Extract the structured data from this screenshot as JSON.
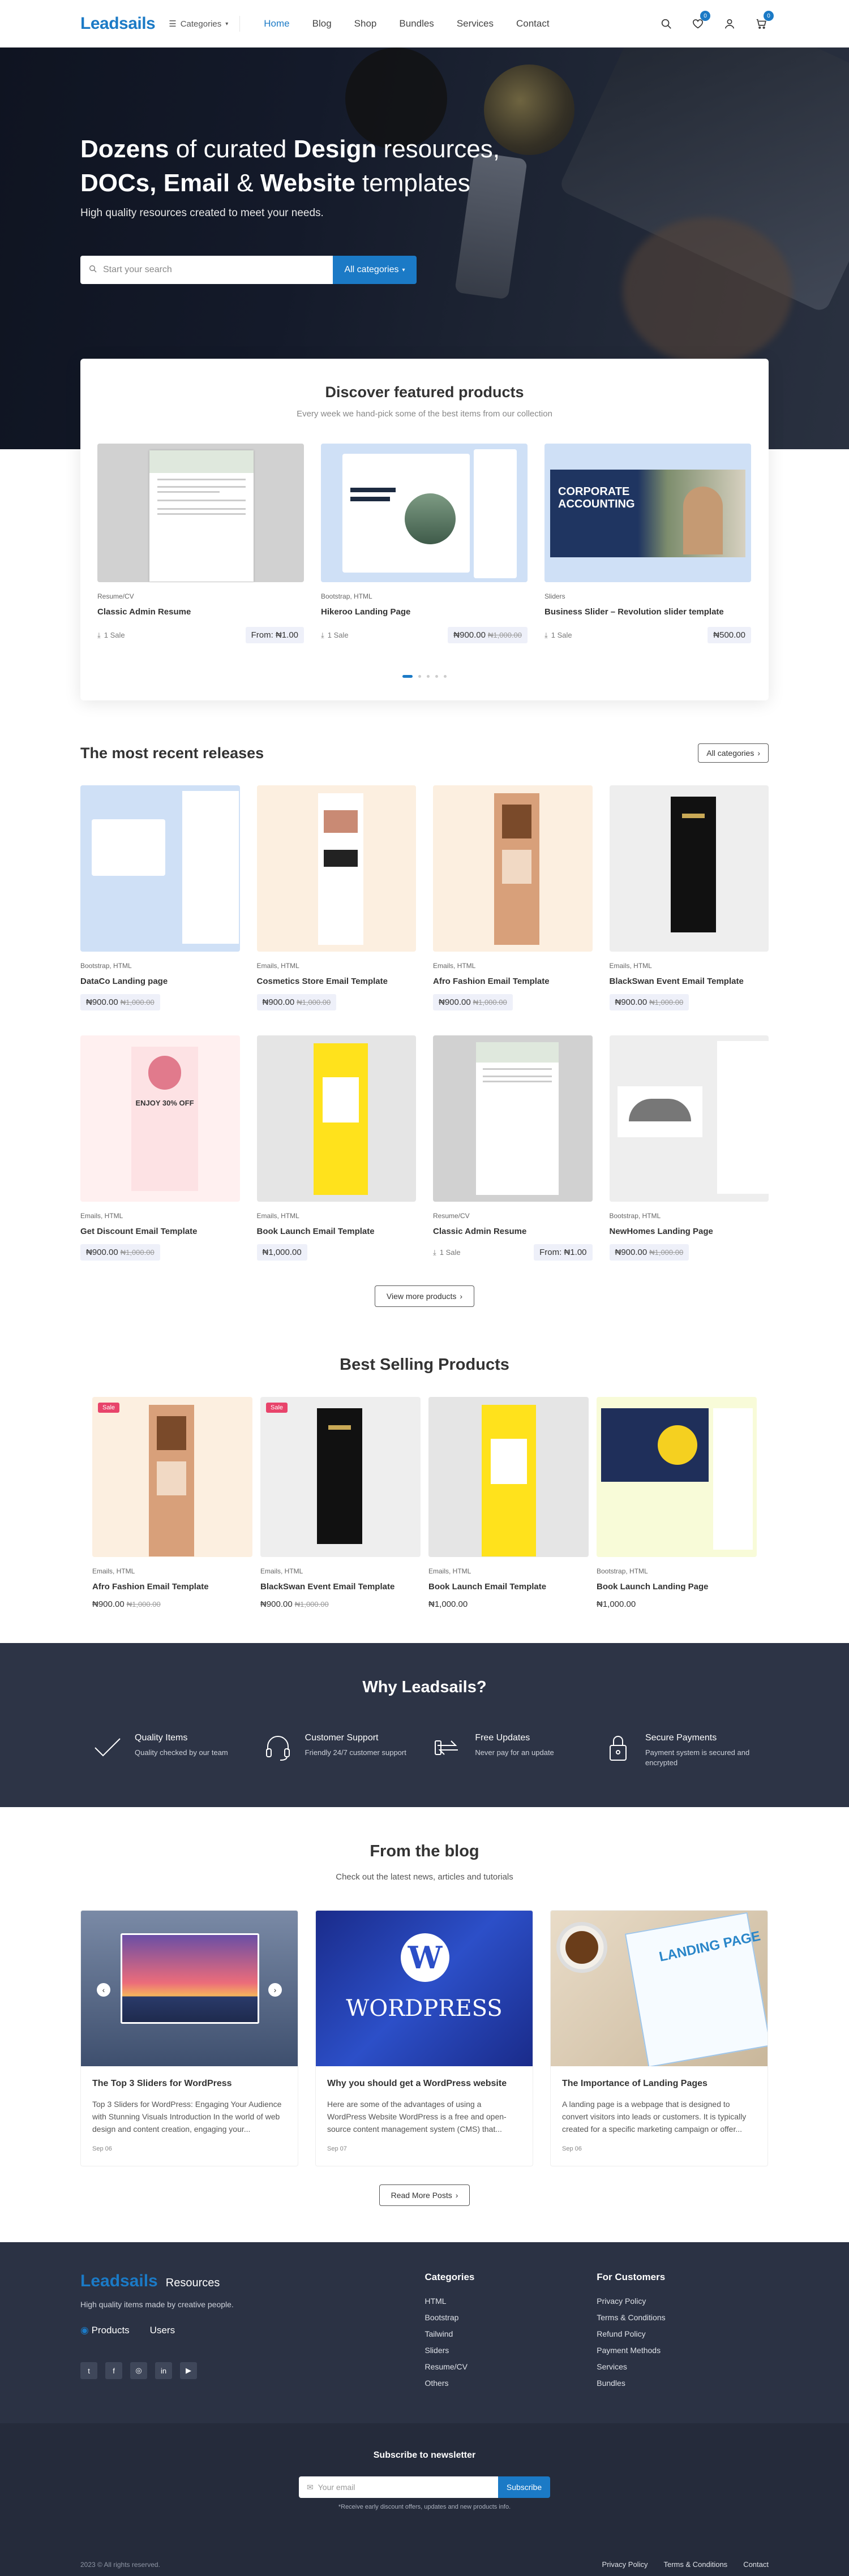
{
  "header": {
    "logo": "Leadsails",
    "categories_label": "Categories",
    "nav": [
      "Home",
      "Blog",
      "Shop",
      "Bundles",
      "Services",
      "Contact"
    ],
    "wishlist_count": "0",
    "cart_count": "0"
  },
  "hero": {
    "line1_a": "Dozens",
    "line1_b": " of curated ",
    "line1_c": "Design",
    "line1_d": " resources,",
    "line2_a": "DOCs, Email",
    "line2_b": " & ",
    "line2_c": "Website",
    "line2_d": " templates",
    "subtitle": "High quality resources created to meet your needs.",
    "search_placeholder": "Start your search",
    "search_button": "All categories"
  },
  "featured": {
    "title": "Discover featured products",
    "subtitle": "Every week we hand-pick some of the best items from our collection",
    "items": [
      {
        "meta": "Resume/CV",
        "name": "Classic Admin Resume",
        "sales": "1 Sale",
        "price": "From: ₦1.00",
        "old": ""
      },
      {
        "meta": "Bootstrap, HTML",
        "name": "Hikeroo Landing Page",
        "sales": "1 Sale",
        "price": "₦900.00",
        "old": "₦1,000.00"
      },
      {
        "meta": "Sliders",
        "name": "Business Slider – Revolution slider template",
        "sales": "1 Sale",
        "price": "₦500.00",
        "old": ""
      }
    ]
  },
  "recent": {
    "title": "The most recent releases",
    "all_button": "All categories",
    "more_button": "View more products",
    "items": [
      {
        "meta": "Bootstrap, HTML",
        "name": "DataCo Landing page",
        "sales": "",
        "price": "₦900.00",
        "old": "₦1,000.00"
      },
      {
        "meta": "Emails, HTML",
        "name": "Cosmetics Store Email Template",
        "sales": "",
        "price": "₦900.00",
        "old": "₦1,000.00"
      },
      {
        "meta": "Emails, HTML",
        "name": "Afro Fashion Email Template",
        "sales": "",
        "price": "₦900.00",
        "old": "₦1,000.00"
      },
      {
        "meta": "Emails, HTML",
        "name": "BlackSwan Event Email Template",
        "sales": "",
        "price": "₦900.00",
        "old": "₦1,000.00"
      },
      {
        "meta": "Emails, HTML",
        "name": "Get Discount Email Template",
        "sales": "",
        "price": "₦900.00",
        "old": "₦1,000.00"
      },
      {
        "meta": "Emails, HTML",
        "name": "Book Launch Email Template",
        "sales": "",
        "price": "₦1,000.00",
        "old": ""
      },
      {
        "meta": "Resume/CV",
        "name": "Classic Admin Resume",
        "sales": "1 Sale",
        "price": "From: ₦1.00",
        "old": ""
      },
      {
        "meta": "Bootstrap, HTML",
        "name": "NewHomes Landing Page",
        "sales": "",
        "price": "₦900.00",
        "old": "₦1,000.00"
      }
    ]
  },
  "best": {
    "title": "Best Selling Products",
    "items": [
      {
        "badge": "Sale",
        "meta": "Emails, HTML",
        "name": "Afro Fashion Email Template",
        "price": "₦900.00",
        "old": "₦1,000.00"
      },
      {
        "badge": "Sale",
        "meta": "Emails, HTML",
        "name": "BlackSwan Event Email Template",
        "price": "₦900.00",
        "old": "₦1,000.00"
      },
      {
        "badge": "",
        "meta": "Emails, HTML",
        "name": "Book Launch Email Template",
        "price": "₦1,000.00",
        "old": ""
      },
      {
        "badge": "",
        "meta": "Bootstrap, HTML",
        "name": "Book Launch Landing Page",
        "price": "₦1,000.00",
        "old": ""
      }
    ]
  },
  "why": {
    "title": "Why Leadsails?",
    "items": [
      {
        "title": "Quality Items",
        "desc": "Quality checked by our team",
        "icon": "check-icon"
      },
      {
        "title": "Customer Support",
        "desc": "Friendly 24/7 customer support",
        "icon": "headset-icon"
      },
      {
        "title": "Free Updates",
        "desc": "Never pay for an update",
        "icon": "refresh-icon"
      },
      {
        "title": "Secure Payments",
        "desc": "Payment system is secured and encrypted",
        "icon": "lock-icon"
      }
    ]
  },
  "blog": {
    "title": "From the blog",
    "subtitle": "Check out the latest news, articles and tutorials",
    "more_button": "Read More Posts",
    "posts": [
      {
        "title": "The Top 3 Sliders for WordPress",
        "excerpt": "Top 3 Sliders for WordPress: Engaging Your Audience with Stunning Visuals Introduction In the world of web design and content creation, engaging your...",
        "date": "Sep 06"
      },
      {
        "title": "Why you should get a WordPress website",
        "excerpt": "Here are some of the advantages of using a WordPress Website WordPress is a free and open-source content management system (CMS) that...",
        "date": "Sep 07"
      },
      {
        "title": "The Importance of Landing Pages",
        "excerpt": "A landing page is a webpage that is designed to convert visitors into leads or customers. It is typically created for a specific marketing campaign or offer...",
        "date": "Sep 06"
      }
    ],
    "img2_text": "WordPress",
    "img3_text": "LANDING PAGE"
  },
  "footer": {
    "logo": "Leadsails",
    "logo_suffix": "Resources",
    "tagline": "High quality items made by creative people.",
    "stat1": "Products",
    "stat2": "Users",
    "categories_title": "Categories",
    "categories": [
      "HTML",
      "Bootstrap",
      "Tailwind",
      "Sliders",
      "Resume/CV",
      "Others"
    ],
    "customers_title": "For Customers",
    "customers": [
      "Privacy Policy",
      "Terms & Conditions",
      "Refund Policy",
      "Payment Methods",
      "Services",
      "Bundles"
    ],
    "newsletter_title": "Subscribe to newsletter",
    "newsletter_placeholder": "Your email",
    "newsletter_button": "Subscribe",
    "newsletter_note": "*Receive early discount offers, updates and new products info.",
    "copyright": "2023 © All rights reserved.",
    "bottom_links": [
      "Privacy Policy",
      "Terms & Conditions",
      "Contact"
    ]
  },
  "colors": {
    "accent": "#1b7ac6",
    "dark": "#2d3446",
    "sale": "#e8446b"
  }
}
